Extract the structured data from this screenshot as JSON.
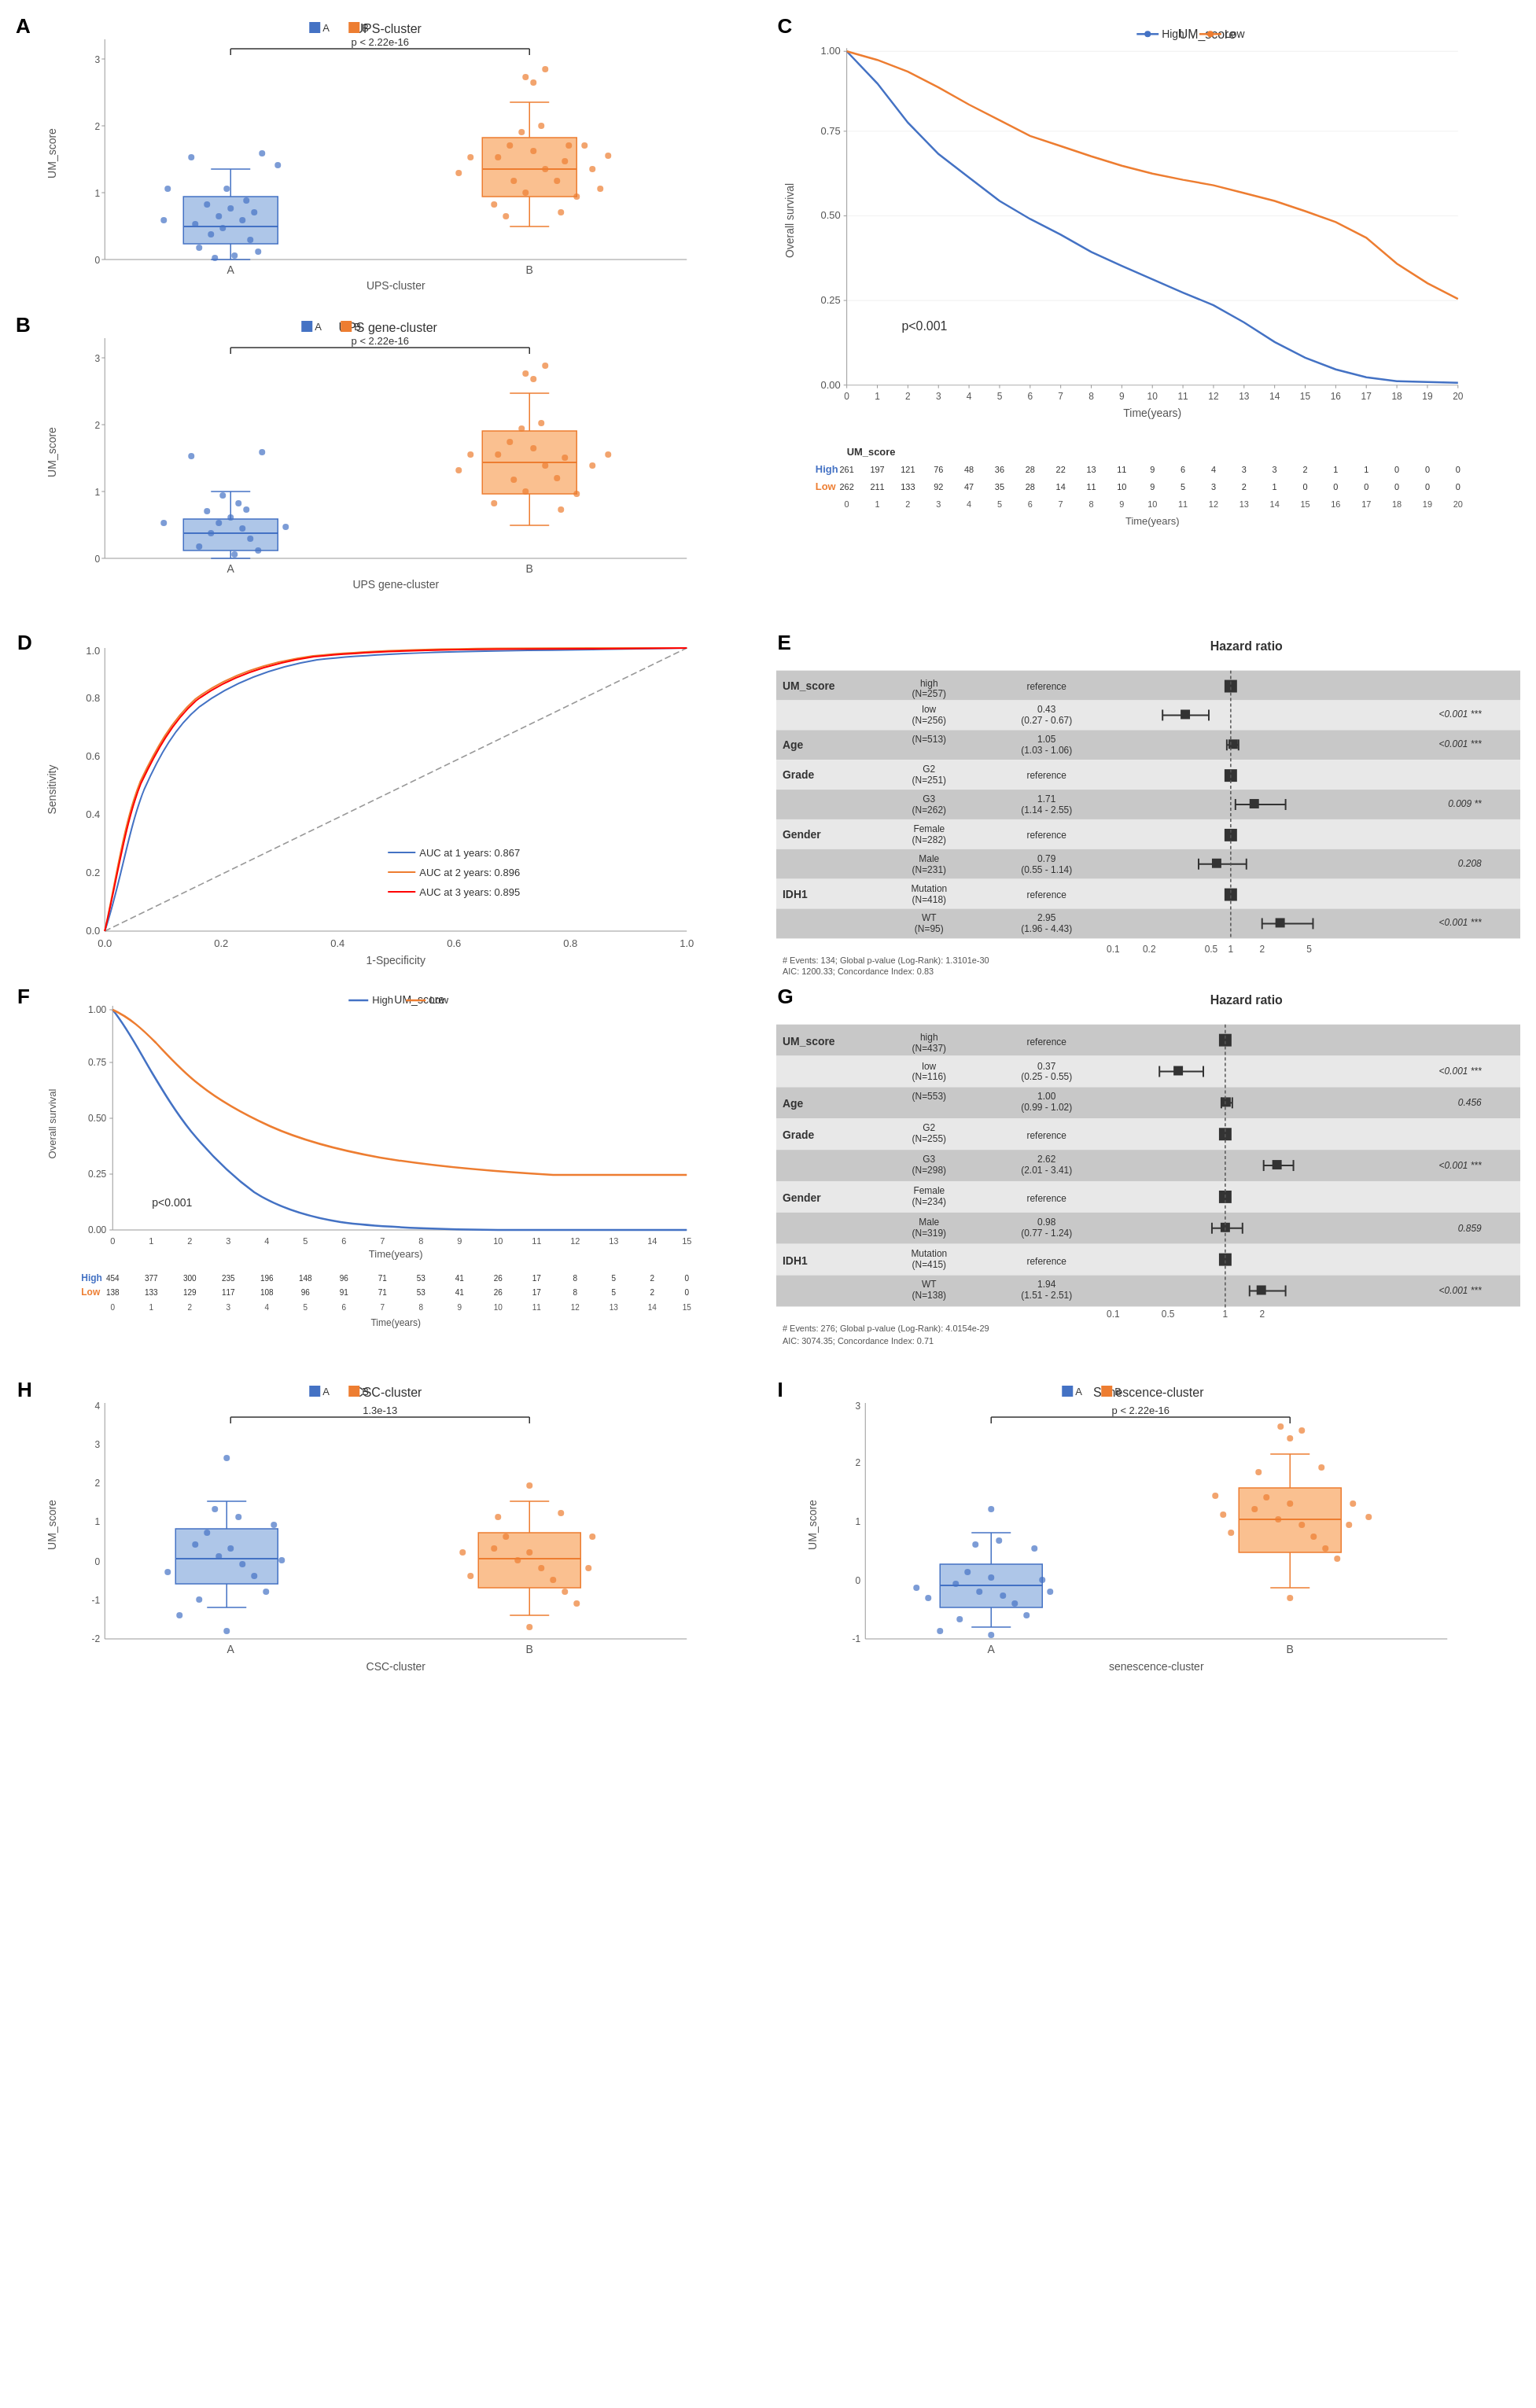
{
  "panels": {
    "A": {
      "label": "A",
      "title": "UPS-cluster",
      "legend": [
        "A",
        "B"
      ],
      "legend_colors": [
        "#4472C4",
        "#ED7D31"
      ],
      "pvalue": "p < 2.22e-16",
      "xaxis": "UPS-cluster",
      "yaxis": "UM_score",
      "xticklabels": [
        "A",
        "B"
      ]
    },
    "B": {
      "label": "B",
      "title": "UPS gene-cluster",
      "legend": [
        "A",
        "B"
      ],
      "legend_colors": [
        "#4472C4",
        "#ED7D31"
      ],
      "pvalue": "p < 2.22e-16",
      "xaxis": "UPS gene-cluster",
      "yaxis": "UM_score",
      "xticklabels": [
        "A",
        "B"
      ]
    },
    "C": {
      "label": "C",
      "title": "UM_score",
      "legend": [
        "High",
        "Low"
      ],
      "legend_colors": [
        "#4472C4",
        "#ED7D31"
      ],
      "pvalue": "p<0.001",
      "xaxis": "Time(years)",
      "yaxis": "Overall survival",
      "yticks": [
        "0.00",
        "0.25",
        "0.50",
        "0.75",
        "1.00"
      ],
      "xticks": [
        "0",
        "1",
        "2",
        "3",
        "4",
        "5",
        "6",
        "7",
        "8",
        "9",
        "10",
        "11",
        "12",
        "13",
        "14",
        "15",
        "16",
        "17",
        "18",
        "19",
        "20"
      ],
      "at_risk": {
        "high_label": "High",
        "low_label": "Low",
        "high_values": "261 197 121 76 48 36 28 22 13 11 9 6 4 3 3 2 1 1 0 0",
        "low_values": "262 211 133 92 47 35 28 14 11 10 9 5 3 2 1 0 0 0 0 0",
        "time_ticks": [
          "0",
          "1",
          "2",
          "3",
          "4",
          "5",
          "6",
          "7",
          "8",
          "9",
          "10",
          "11",
          "12",
          "13",
          "14",
          "15",
          "16",
          "17",
          "18",
          "19",
          "20"
        ]
      }
    },
    "D": {
      "label": "D",
      "xaxis": "1-Specificity",
      "yaxis": "Sensitivity",
      "yticks": [
        "0.0",
        "0.2",
        "0.4",
        "0.6",
        "0.8",
        "1.0"
      ],
      "xticks": [
        "0.0",
        "0.2",
        "0.4",
        "0.6",
        "0.8",
        "1.0"
      ],
      "curves": [
        {
          "label": "AUC at 1 years: 0.867",
          "color": "#4472C4"
        },
        {
          "label": "AUC at 2 years: 0.896",
          "color": "#ED7D31"
        },
        {
          "label": "AUC at 3 years: 0.895",
          "color": "#FF0000"
        }
      ]
    },
    "E": {
      "label": "E",
      "title": "Hazard ratio",
      "rows": [
        {
          "variable": "UM_score",
          "subgroup": "high\n(N=257)",
          "estimate": "reference",
          "hr": null,
          "pval": null,
          "sig": null,
          "ref": true
        },
        {
          "variable": "",
          "subgroup": "low\n(N=256)",
          "estimate": "0.43\n(0.27 - 0.67)",
          "hr": 0.43,
          "ci_low": 0.27,
          "ci_high": 0.67,
          "pval": "<0.001 ***",
          "ref": false
        },
        {
          "variable": "Age",
          "subgroup": "(N=513)",
          "estimate": "1.05\n(1.03 - 1.06)",
          "hr": 1.05,
          "ci_low": 1.03,
          "ci_high": 1.06,
          "pval": "<0.001 ***",
          "ref": false
        },
        {
          "variable": "Grade",
          "subgroup": "G2\n(N=251)",
          "estimate": "reference",
          "hr": null,
          "pval": null,
          "sig": null,
          "ref": true
        },
        {
          "variable": "",
          "subgroup": "G3\n(N=262)",
          "estimate": "1.71\n(1.14 - 2.55)",
          "hr": 1.71,
          "ci_low": 1.14,
          "ci_high": 2.55,
          "pval": "0.009 **",
          "ref": false
        },
        {
          "variable": "Gender",
          "subgroup": "Female\n(N=282)",
          "estimate": "reference",
          "hr": null,
          "pval": null,
          "sig": null,
          "ref": true
        },
        {
          "variable": "",
          "subgroup": "Male\n(N=231)",
          "estimate": "0.79\n(0.55 - 1.14)",
          "hr": 0.79,
          "ci_low": 0.55,
          "ci_high": 1.14,
          "pval": "0.208",
          "ref": false
        },
        {
          "variable": "IDH1",
          "subgroup": "Mutation\n(N=418)",
          "estimate": "reference",
          "hr": null,
          "pval": null,
          "sig": null,
          "ref": true
        },
        {
          "variable": "",
          "subgroup": "WT\n(N=95)",
          "estimate": "2.95\n(1.96 - 4.43)",
          "hr": 2.95,
          "ci_low": 1.96,
          "ci_high": 4.43,
          "pval": "<0.001 ***",
          "ref": false
        }
      ],
      "footer": "# Events: 134; Global p-value (Log-Rank): 1.3101e-30\nAIC: 1200.33; Concordance Index: 0.83",
      "xaxis_ticks": [
        "0.1",
        "0.2",
        "0.5",
        "1",
        "2",
        "5"
      ]
    },
    "F": {
      "label": "F",
      "title": "UM_score",
      "legend": [
        "High",
        "Low"
      ],
      "legend_colors": [
        "#4472C4",
        "#ED7D31"
      ],
      "pvalue": "p<0.001",
      "xaxis": "Time(years)",
      "yaxis": "Overall survival",
      "yticks": [
        "0.00",
        "0.25",
        "0.50",
        "0.75",
        "1.00"
      ],
      "xticks": [
        "0",
        "1",
        "2",
        "3",
        "4",
        "5",
        "6",
        "7",
        "8",
        "9",
        "10",
        "11",
        "12",
        "13",
        "14",
        "15"
      ],
      "at_risk": {
        "high_label": "High",
        "low_label": "Low",
        "high_values": "454 377 300 235 196 148 96 71 53 41 26 17 8 5 2 0",
        "low_values": "138 133 129 117 108 96 91 71 53 41 26 17 8 5 2 0",
        "time_ticks": [
          "0",
          "1",
          "2",
          "3",
          "4",
          "5",
          "6",
          "7",
          "8",
          "9",
          "10",
          "11",
          "12",
          "13",
          "14",
          "15"
        ]
      }
    },
    "G": {
      "label": "G",
      "title": "Hazard ratio",
      "rows": [
        {
          "variable": "UM_score",
          "subgroup": "high\n(N=437)",
          "estimate": "reference",
          "hr": null,
          "pval": null,
          "sig": null,
          "ref": true
        },
        {
          "variable": "",
          "subgroup": "low\n(N=116)",
          "estimate": "0.37\n(0.25 - 0.55)",
          "hr": 0.37,
          "ci_low": 0.25,
          "ci_high": 0.55,
          "pval": "<0.001 ***",
          "ref": false
        },
        {
          "variable": "Age",
          "subgroup": "(N=553)",
          "estimate": "1.00\n(0.99 - 1.02)",
          "hr": 1.0,
          "ci_low": 0.99,
          "ci_high": 1.02,
          "pval": "0.456",
          "ref": false
        },
        {
          "variable": "Grade",
          "subgroup": "G2\n(N=255)",
          "estimate": "reference",
          "hr": null,
          "pval": null,
          "sig": null,
          "ref": true
        },
        {
          "variable": "",
          "subgroup": "G3\n(N=298)",
          "estimate": "2.62\n(2.01 - 3.41)",
          "hr": 2.62,
          "ci_low": 2.01,
          "ci_high": 3.41,
          "pval": "<0.001 ***",
          "ref": false
        },
        {
          "variable": "Gender",
          "subgroup": "Female\n(N=234)",
          "estimate": "reference",
          "hr": null,
          "pval": null,
          "sig": null,
          "ref": true
        },
        {
          "variable": "",
          "subgroup": "Male\n(N=319)",
          "estimate": "0.98\n(0.77 - 1.24)",
          "hr": 0.98,
          "ci_low": 0.77,
          "ci_high": 1.24,
          "pval": "0.859",
          "ref": false
        },
        {
          "variable": "IDH1",
          "subgroup": "Mutation\n(N=415)",
          "estimate": "reference",
          "hr": null,
          "pval": null,
          "sig": null,
          "ref": true
        },
        {
          "variable": "",
          "subgroup": "WT\n(N=138)",
          "estimate": "1.94\n(1.51 - 2.51)",
          "hr": 1.94,
          "ci_low": 1.51,
          "ci_high": 2.51,
          "pval": "<0.001 ***",
          "ref": false
        }
      ],
      "footer": "# Events: 276; Global p-value (Log-Rank): 4.0154e-29\nAIC: 3074.35; Concordance Index: 0.71",
      "xaxis_ticks": [
        "0.1",
        "0.5",
        "1",
        "2"
      ]
    },
    "H": {
      "label": "H",
      "title": "CSC-cluster",
      "legend": [
        "A",
        "B"
      ],
      "legend_colors": [
        "#4472C4",
        "#ED7D31"
      ],
      "pvalue": "1.3e-13",
      "xaxis": "CSC-cluster",
      "yaxis": "UM_score",
      "xticklabels": [
        "A",
        "B"
      ]
    },
    "I": {
      "label": "I",
      "title": "Senescence-cluster",
      "legend": [
        "A",
        "B"
      ],
      "legend_colors": [
        "#4472C4",
        "#ED7D31"
      ],
      "pvalue": "p < 2.22e-16",
      "xaxis": "senescence-cluster",
      "yaxis": "UM_score",
      "xticklabels": [
        "A",
        "B"
      ]
    }
  },
  "colors": {
    "blue": "#4472C4",
    "orange": "#ED7D31",
    "red": "#FF0000",
    "grid": "#e0e0e0",
    "box_fill_blue": "#AEC6E8",
    "box_fill_orange": "#FAC090",
    "forest_bg_dark": "#C0C0C0",
    "forest_bg_light": "#E8E8E8"
  }
}
